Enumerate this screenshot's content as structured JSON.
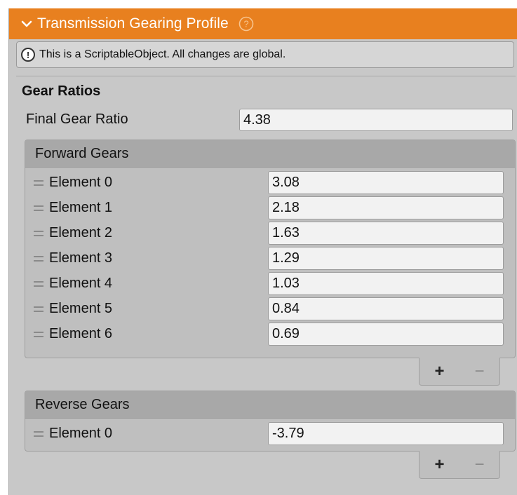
{
  "header": {
    "title": "Transmission Gearing Profile",
    "accent": "#e8801f"
  },
  "notice": {
    "text": "This is a ScriptableObject. All changes are global."
  },
  "gear_ratios": {
    "title": "Gear Ratios",
    "final_gear_ratio": {
      "label": "Final Gear Ratio",
      "value": "4.38"
    }
  },
  "forward_gears": {
    "title": "Forward Gears",
    "elements": [
      {
        "label": "Element 0",
        "value": "3.08"
      },
      {
        "label": "Element 1",
        "value": "2.18"
      },
      {
        "label": "Element 2",
        "value": "1.63"
      },
      {
        "label": "Element 3",
        "value": "1.29"
      },
      {
        "label": "Element 4",
        "value": "1.03"
      },
      {
        "label": "Element 5",
        "value": "0.84"
      },
      {
        "label": "Element 6",
        "value": "0.69"
      }
    ],
    "add_label": "+",
    "remove_label": "−"
  },
  "reverse_gears": {
    "title": "Reverse Gears",
    "elements": [
      {
        "label": "Element 0",
        "value": "-3.79"
      }
    ],
    "add_label": "+",
    "remove_label": "−"
  }
}
